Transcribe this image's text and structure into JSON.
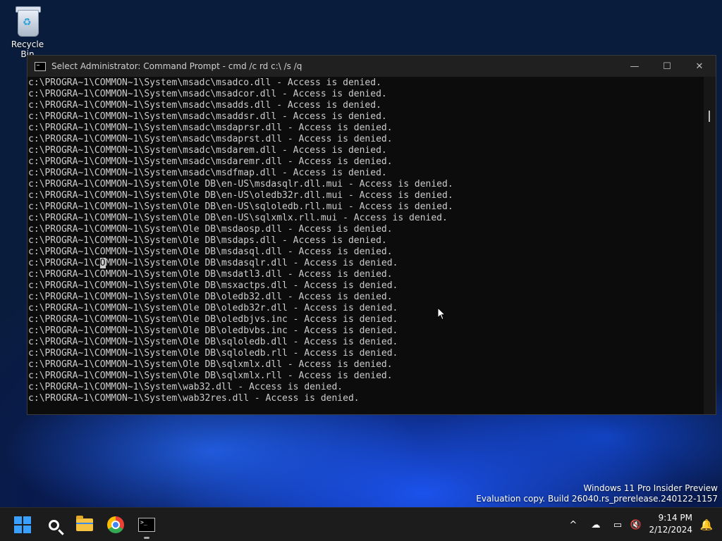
{
  "desktop": {
    "recycle_bin_label": "Recycle Bin"
  },
  "window": {
    "title": "Select Administrator: Command Prompt - cmd  /c rd c:\\ /s /q",
    "minimize": "—",
    "maximize": "☐",
    "close": "✕"
  },
  "console": {
    "lines": [
      "c:\\PROGRA~1\\COMMON~1\\System\\msadc\\msadco.dll - Access is denied.",
      "c:\\PROGRA~1\\COMMON~1\\System\\msadc\\msadcor.dll - Access is denied.",
      "c:\\PROGRA~1\\COMMON~1\\System\\msadc\\msadds.dll - Access is denied.",
      "c:\\PROGRA~1\\COMMON~1\\System\\msadc\\msaddsr.dll - Access is denied.",
      "c:\\PROGRA~1\\COMMON~1\\System\\msadc\\msdaprsr.dll - Access is denied.",
      "c:\\PROGRA~1\\COMMON~1\\System\\msadc\\msdaprst.dll - Access is denied.",
      "c:\\PROGRA~1\\COMMON~1\\System\\msadc\\msdarem.dll - Access is denied.",
      "c:\\PROGRA~1\\COMMON~1\\System\\msadc\\msdaremr.dll - Access is denied.",
      "c:\\PROGRA~1\\COMMON~1\\System\\msadc\\msdfmap.dll - Access is denied.",
      "c:\\PROGRA~1\\COMMON~1\\System\\Ole DB\\en-US\\msdasqlr.dll.mui - Access is denied.",
      "c:\\PROGRA~1\\COMMON~1\\System\\Ole DB\\en-US\\oledb32r.dll.mui - Access is denied.",
      "c:\\PROGRA~1\\COMMON~1\\System\\Ole DB\\en-US\\sqloledb.rll.mui - Access is denied.",
      "c:\\PROGRA~1\\COMMON~1\\System\\Ole DB\\en-US\\sqlxmlx.rll.mui - Access is denied.",
      "c:\\PROGRA~1\\COMMON~1\\System\\Ole DB\\msdaosp.dll - Access is denied.",
      "c:\\PROGRA~1\\COMMON~1\\System\\Ole DB\\msdaps.dll - Access is denied.",
      "c:\\PROGRA~1\\COMMON~1\\System\\Ole DB\\msdasql.dll - Access is denied.",
      "c:\\PROGRA~1\\COMMON~1\\System\\Ole DB\\msdasqlr.dll - Access is denied.",
      "c:\\PROGRA~1\\COMMON~1\\System\\Ole DB\\msdatl3.dll - Access is denied.",
      "c:\\PROGRA~1\\COMMON~1\\System\\Ole DB\\msxactps.dll - Access is denied.",
      "c:\\PROGRA~1\\COMMON~1\\System\\Ole DB\\oledb32.dll - Access is denied.",
      "c:\\PROGRA~1\\COMMON~1\\System\\Ole DB\\oledb32r.dll - Access is denied.",
      "c:\\PROGRA~1\\COMMON~1\\System\\Ole DB\\oledbjvs.inc - Access is denied.",
      "c:\\PROGRA~1\\COMMON~1\\System\\Ole DB\\oledbvbs.inc - Access is denied.",
      "c:\\PROGRA~1\\COMMON~1\\System\\Ole DB\\sqloledb.dll - Access is denied.",
      "c:\\PROGRA~1\\COMMON~1\\System\\Ole DB\\sqloledb.rll - Access is denied.",
      "c:\\PROGRA~1\\COMMON~1\\System\\Ole DB\\sqlxmlx.dll - Access is denied.",
      "c:\\PROGRA~1\\COMMON~1\\System\\Ole DB\\sqlxmlx.rll - Access is denied.",
      "c:\\PROGRA~1\\COMMON~1\\System\\wab32.dll - Access is denied.",
      "c:\\PROGRA~1\\COMMON~1\\System\\wab32res.dll - Access is denied."
    ],
    "selection_line": 16,
    "selection_char": 13
  },
  "watermark": {
    "line1": "Windows 11 Pro Insider Preview",
    "line2": "Evaluation copy. Build 26040.rs_prerelease.240122-1157"
  },
  "taskbar": {
    "items": [
      "start-button",
      "search",
      "file-explorer",
      "chrome",
      "command-prompt"
    ],
    "tray": {
      "chevron": "^",
      "onedrive": "☁",
      "network": "▭",
      "volume": "🔇"
    },
    "time": "9:14 PM",
    "date": "2/12/2024",
    "accent_color": "#3aa0ff"
  }
}
